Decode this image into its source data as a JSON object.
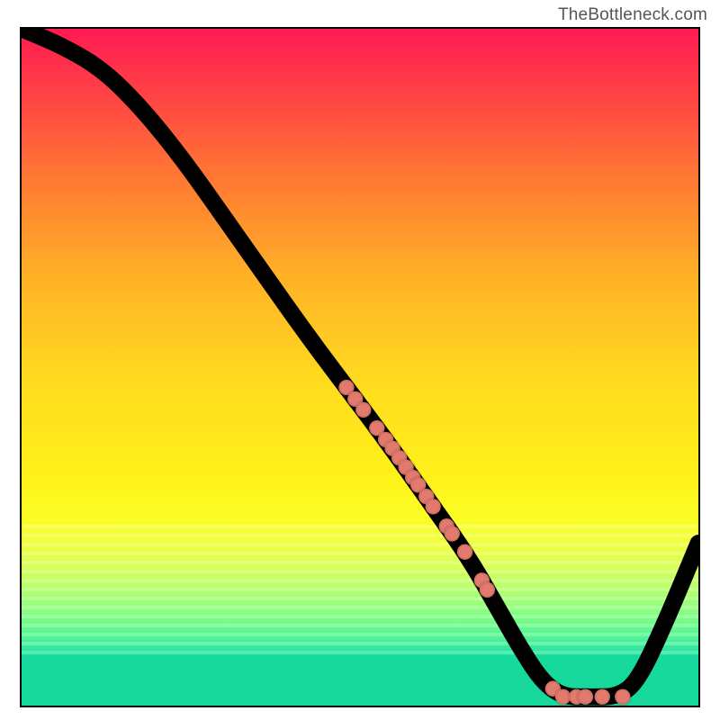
{
  "watermark": "TheBottleneck.com",
  "chart_data": {
    "type": "line",
    "title": "",
    "xlabel": "",
    "ylabel": "",
    "xlim": [
      0,
      100
    ],
    "ylim": [
      0,
      100
    ],
    "curve": [
      {
        "x": 0,
        "y": 100
      },
      {
        "x": 6,
        "y": 97.5
      },
      {
        "x": 12,
        "y": 94
      },
      {
        "x": 18,
        "y": 88
      },
      {
        "x": 24,
        "y": 80.5
      },
      {
        "x": 30,
        "y": 72
      },
      {
        "x": 36,
        "y": 63.5
      },
      {
        "x": 42,
        "y": 55
      },
      {
        "x": 48,
        "y": 47
      },
      {
        "x": 54,
        "y": 39
      },
      {
        "x": 60,
        "y": 30.5
      },
      {
        "x": 66,
        "y": 22
      },
      {
        "x": 70,
        "y": 15
      },
      {
        "x": 74,
        "y": 8
      },
      {
        "x": 77,
        "y": 3.5
      },
      {
        "x": 80,
        "y": 1.3
      },
      {
        "x": 84,
        "y": 1.3
      },
      {
        "x": 88,
        "y": 1.3
      },
      {
        "x": 91,
        "y": 3.5
      },
      {
        "x": 95,
        "y": 12
      },
      {
        "x": 100,
        "y": 24
      }
    ],
    "highlighted_points": [
      {
        "x": 48.0,
        "y": 47.0
      },
      {
        "x": 49.3,
        "y": 45.3
      },
      {
        "x": 50.5,
        "y": 43.7
      },
      {
        "x": 52.5,
        "y": 41.0
      },
      {
        "x": 53.8,
        "y": 39.3
      },
      {
        "x": 54.8,
        "y": 38.0
      },
      {
        "x": 55.8,
        "y": 36.6
      },
      {
        "x": 56.8,
        "y": 35.2
      },
      {
        "x": 57.8,
        "y": 33.7
      },
      {
        "x": 58.6,
        "y": 32.6
      },
      {
        "x": 59.8,
        "y": 30.9
      },
      {
        "x": 60.8,
        "y": 29.4
      },
      {
        "x": 62.8,
        "y": 26.5
      },
      {
        "x": 63.6,
        "y": 25.4
      },
      {
        "x": 65.5,
        "y": 22.7
      },
      {
        "x": 68.0,
        "y": 18.5
      },
      {
        "x": 68.8,
        "y": 17.1
      },
      {
        "x": 78.5,
        "y": 2.5
      },
      {
        "x": 80.0,
        "y": 1.3
      },
      {
        "x": 82.0,
        "y": 1.3
      },
      {
        "x": 83.3,
        "y": 1.3
      },
      {
        "x": 85.8,
        "y": 1.3
      },
      {
        "x": 88.8,
        "y": 1.3
      }
    ],
    "gradient_stops": [
      {
        "y": 100,
        "color": "#ff1a53"
      },
      {
        "y": 50,
        "color": "#ffdb1f"
      },
      {
        "y": 27.5,
        "color": "#fbff25"
      },
      {
        "y": 7.5,
        "color": "#1ee2a0"
      },
      {
        "y": 0,
        "color": "#17d99b"
      }
    ]
  }
}
